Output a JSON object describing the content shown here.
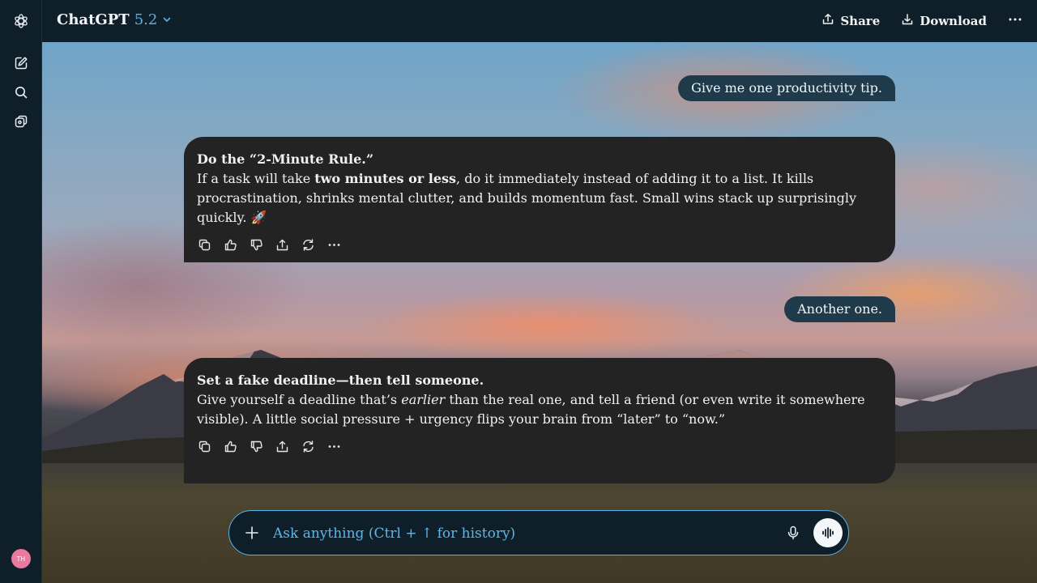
{
  "header": {
    "model_name": "ChatGPT",
    "model_version": "5.2",
    "share_label": "Share",
    "download_label": "Download"
  },
  "sidebar": {
    "items": [
      {
        "icon": "openai-logo-icon"
      },
      {
        "icon": "new-chat-icon"
      },
      {
        "icon": "search-icon"
      },
      {
        "icon": "library-icon"
      }
    ],
    "avatar_initials": "TH"
  },
  "messages": [
    {
      "role": "user",
      "text": "Give me one productivity tip."
    },
    {
      "role": "assistant",
      "title": "Do the “2-Minute Rule.”",
      "body_pre": "If a task will take ",
      "body_bold": "two minutes or less",
      "body_post": ", do it immediately instead of adding it to a list. It kills procrastination, shrinks mental clutter, and builds momentum fast. Small wins stack up surprisingly quickly. 🚀"
    },
    {
      "role": "user",
      "text": "Another one."
    },
    {
      "role": "assistant",
      "title": "Set a fake deadline—then tell someone.",
      "body_pre": "Give yourself a deadline that’s ",
      "body_em": "earlier",
      "body_post": " than the real one, and tell a friend (or even write it somewhere visible). A little social pressure + urgency flips your brain from “later” to “now.”"
    }
  ],
  "message_actions": [
    "copy-icon",
    "thumbs-up-icon",
    "thumbs-down-icon",
    "share-icon",
    "regenerate-icon",
    "more-icon"
  ],
  "composer": {
    "placeholder": "Ask anything (Ctrl + ↑ for history)"
  },
  "colors": {
    "accent": "#5bb4e6",
    "sidebar_bg": "#0f1f29",
    "user_bubble": "#1f3a4a",
    "assistant_bubble": "#232323",
    "avatar": "#e9799f"
  }
}
